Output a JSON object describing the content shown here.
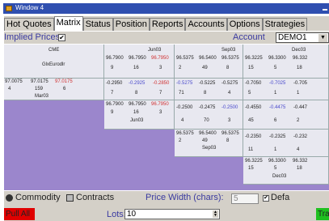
{
  "window": {
    "title": "Window 4"
  },
  "tabs": [
    "Hot Quotes",
    "Matrix",
    "Status",
    "Position",
    "Reports",
    "Accounts",
    "Options",
    "Strategies"
  ],
  "active_tab": "Matrix",
  "toolbar": {
    "implied_prices_label": "Implied Prices",
    "implied_checked": "✔",
    "account_label": "Account",
    "account_value": "DEMO1"
  },
  "header": {
    "exchange": "CME",
    "product": "GlxEurodlr",
    "spot": {
      "bid": "97.0075",
      "last": "97.0175",
      "ask": "97.0175",
      "bq": "4",
      "vol": "159",
      "aq": "6",
      "month": "Mar03"
    },
    "cols": [
      {
        "bid": "96.7900",
        "last": "96.7950",
        "ask": "96.7950",
        "bq": "9",
        "vol": "16",
        "aq": "3",
        "month": "Jun03"
      },
      {
        "bid": "96.5375",
        "last": "96.5400",
        "ask": "96.5375",
        "bq": "2",
        "vol": "49",
        "aq": "8",
        "month": "Sep03"
      },
      {
        "bid": "96.3225",
        "last": "96.3300",
        "ask": "96.332",
        "bq": "15",
        "vol": "5",
        "aq": "18",
        "month": "Dec03"
      }
    ]
  },
  "spreads_row1": [
    {
      "b": "-0.2950",
      "m": "-0.2925",
      "a": "-0.2850",
      "c1": "7",
      "c2": "8",
      "c3": "7"
    },
    {
      "b": "-0.5275",
      "m": "-0.5225",
      "a": "-0.5275",
      "c1": "71",
      "c2": "8",
      "c3": "4"
    },
    {
      "b": "-0.7050",
      "m": "-0.7025",
      "a": "-0.705",
      "c1": "5",
      "c2": "1",
      "c3": "1"
    }
  ],
  "row2": {
    "diag": {
      "bid": "96.7900",
      "last": "96.7950",
      "ask": "96.7950",
      "bq": "9",
      "vol": "16",
      "aq": "3",
      "month": "Jun03"
    },
    "s1": {
      "b": "-0.2500",
      "m": "-0.2475",
      "a": "-0.2500",
      "c1": "4",
      "c2": "70",
      "c3": "3"
    },
    "s2": {
      "b": "-0.4550",
      "m": "-0.4475",
      "a": "-0.447",
      "c1": "45",
      "c2": "6",
      "c3": "2"
    }
  },
  "row3": {
    "diag": {
      "bid": "96.5375",
      "last": "96.5400",
      "ask": "96.5375",
      "bq": "2",
      "vol": "49",
      "aq": "8",
      "month": "Sep03"
    },
    "s1": {
      "b": "-0.2350",
      "m": "-0.2325",
      "a": "-0.232",
      "c1": "11",
      "c2": "1",
      "c3": "4"
    }
  },
  "row4": {
    "diag": {
      "bid": "96.3225",
      "last": "96.3300",
      "ask": "96.332",
      "bq": "15",
      "vol": "5",
      "aq": "18",
      "month": "Dec03"
    }
  },
  "bottom": {
    "commodity": "Commodity",
    "contracts": "Contracts",
    "price_width_label": "Price Width (chars):",
    "price_width_value": "5",
    "default_label": "Defa",
    "pull_all": "Pull All",
    "lots_label": "Lots:",
    "lots_value": "10",
    "trade": "Tra"
  },
  "colors": {
    "grid_bg": "#9b86cc",
    "cell_bg": "#e8e8f0",
    "red": "#d03030",
    "pull": "#e00000",
    "trade": "#1fc01f"
  }
}
